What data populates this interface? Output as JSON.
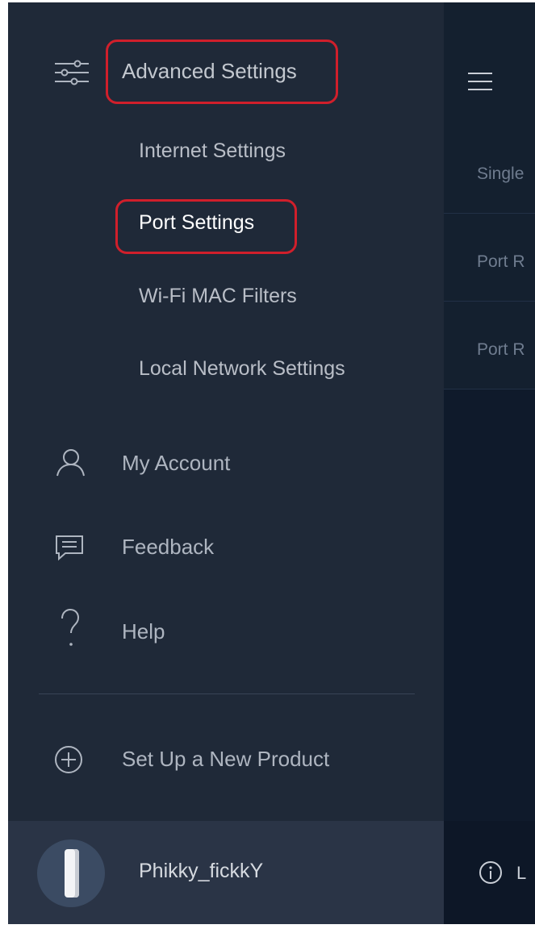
{
  "drawer": {
    "advanced_settings": "Advanced Settings",
    "sub_items": [
      {
        "label": "Internet Settings"
      },
      {
        "label": "Port Settings"
      },
      {
        "label": "Wi-Fi MAC Filters"
      },
      {
        "label": "Local Network Settings"
      }
    ],
    "my_account": "My Account",
    "feedback": "Feedback",
    "help": "Help",
    "setup_product": "Set Up a New Product",
    "username": "Phikky_fickkY"
  },
  "background_app": {
    "rows": [
      "Single",
      "Port R",
      "Port R"
    ],
    "footer_trailing": "L"
  },
  "colors": {
    "highlight": "#d01f2b",
    "drawer_bg": "#1f2938",
    "right_bg": "#0f1a2b"
  }
}
